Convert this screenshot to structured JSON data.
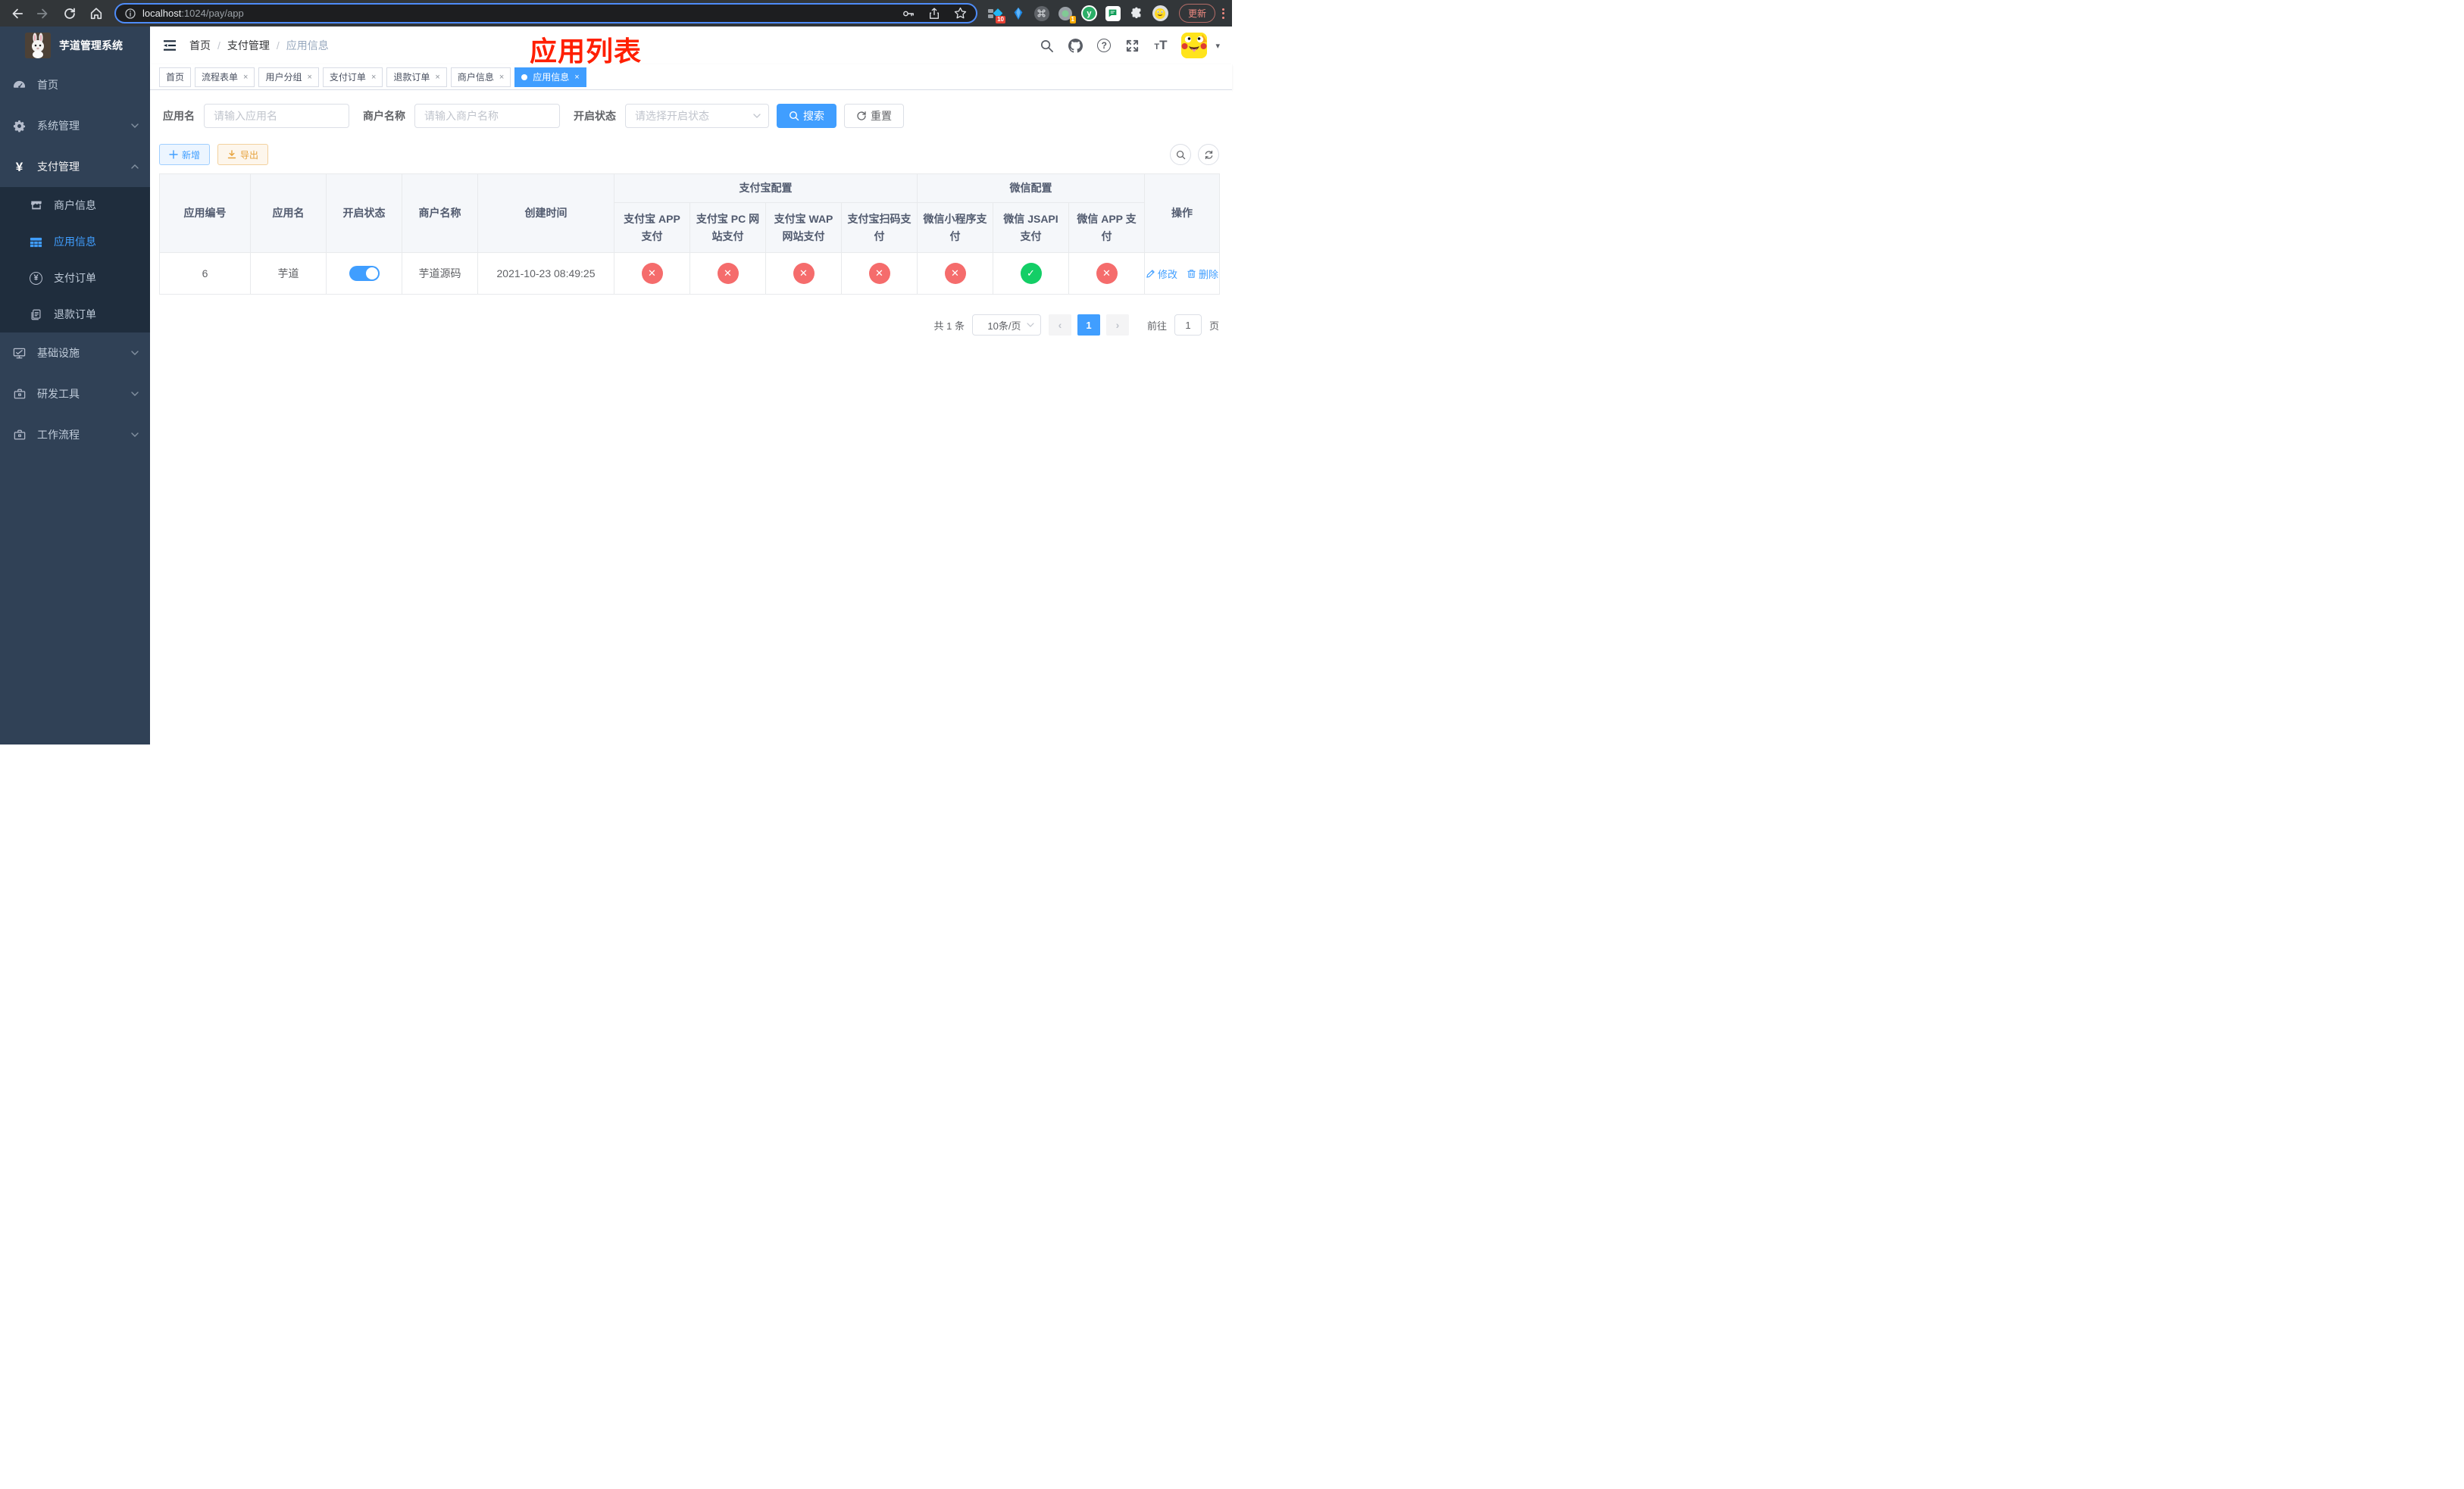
{
  "browser": {
    "url_host": "localhost",
    "url_rest": ":1024/pay/app",
    "update_label": "更新",
    "ext_badge_10": "10",
    "ext_badge_1": "1",
    "ext_y_letter": "y"
  },
  "sidebar": {
    "title": "芋道管理系统",
    "items": [
      {
        "label": "首页"
      },
      {
        "label": "系统管理"
      },
      {
        "label": "支付管理"
      },
      {
        "label": "基础设施"
      },
      {
        "label": "研发工具"
      },
      {
        "label": "工作流程"
      }
    ],
    "sub_items": [
      {
        "label": "商户信息"
      },
      {
        "label": "应用信息"
      },
      {
        "label": "支付订单"
      },
      {
        "label": "退款订单"
      }
    ]
  },
  "breadcrumb": {
    "items": [
      "首页",
      "支付管理",
      "应用信息"
    ],
    "separator": "/"
  },
  "annotation": {
    "title": "应用列表"
  },
  "tabs": [
    {
      "label": "首页"
    },
    {
      "label": "流程表单"
    },
    {
      "label": "用户分组"
    },
    {
      "label": "支付订单"
    },
    {
      "label": "退款订单"
    },
    {
      "label": "商户信息"
    },
    {
      "label": "应用信息"
    }
  ],
  "filters": {
    "app_name_label": "应用名",
    "app_name_placeholder": "请输入应用名",
    "merchant_label": "商户名称",
    "merchant_placeholder": "请输入商户名称",
    "status_label": "开启状态",
    "status_placeholder": "请选择开启状态",
    "search_label": "搜索",
    "reset_label": "重置"
  },
  "toolbar": {
    "add_label": "新增",
    "export_label": "导出"
  },
  "table": {
    "columns": [
      "应用编号",
      "应用名",
      "开启状态",
      "商户名称",
      "创建时间",
      "操作"
    ],
    "groups": [
      "支付宝配置",
      "微信配置"
    ],
    "sub_columns": [
      "支付宝 APP 支付",
      "支付宝 PC 网站支付",
      "支付宝 WAP 网站支付",
      "支付宝扫码支付",
      "微信小程序支付",
      "微信 JSAPI 支付",
      "微信 APP 支付"
    ],
    "row": {
      "id": "6",
      "name": "芋道",
      "enabled": true,
      "merchant": "芋道源码",
      "created": "2021-10-23 08:49:25",
      "configs": [
        false,
        false,
        false,
        false,
        false,
        true,
        false
      ]
    },
    "ops": {
      "edit": "修改",
      "delete": "删除"
    }
  },
  "pagination": {
    "total": "共 1 条",
    "page_size": "10条/页",
    "current": "1",
    "goto_label": "前往",
    "goto_value": "1",
    "unit": "页"
  },
  "glyphs": {
    "close": "×",
    "cross": "✕",
    "check": "✓",
    "question": "?",
    "caret": "▾",
    "prev": "‹",
    "next": "›",
    "yen": "¥"
  },
  "colors": {
    "primary": "#409EFF",
    "danger": "#f56c6c",
    "success": "#13ce66",
    "warning": "#e6a23c",
    "sidebar_bg": "#304156",
    "submenu_bg": "#1f2d3d",
    "annotation_red": "#ff1f00"
  }
}
